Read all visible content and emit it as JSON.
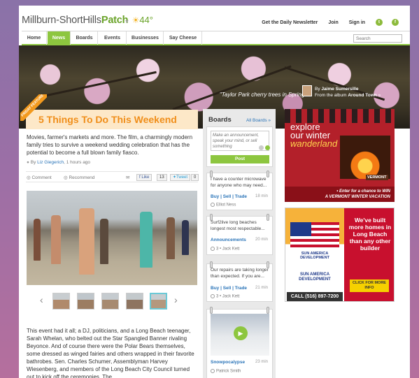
{
  "header": {
    "logo_main": "Millburn-ShortHills",
    "logo_brand": "Patch",
    "temperature": "44°",
    "weather_icon": "sun-icon",
    "links": [
      "Get the Daily Newsletter",
      "Join",
      "Sign in"
    ],
    "social": [
      "twitter-icon",
      "facebook-icon"
    ]
  },
  "nav": {
    "items": [
      "Home",
      "News",
      "Boards",
      "Events",
      "Businesses",
      "Say Cheese"
    ],
    "active": "News",
    "search_placeholder": "Search"
  },
  "hero": {
    "caption": "\"Taylor Park cherry trees in Spring\"",
    "by_prefix": "By",
    "author": "Jaime Sumersille",
    "album_prefix": "From the album",
    "album": "Around Town",
    "album_arrow": "»"
  },
  "article": {
    "ribbon": "FRIDAY FEATURE",
    "title": "5 Things To Do This Weekend",
    "summary": "Movies, farmer's markets and more. The film, a charmingly modern family tries to survive a weekend wedding celebration that has the potential to become a full blown family fiasco.",
    "byline_prefix": "By",
    "author": "Liz Giegerich",
    "time": ", 1 hours ago",
    "comment_label": "Comment",
    "recommend_label": "Recommend",
    "like_label": "Like",
    "like_count": "13",
    "tweet_label": "Tweet",
    "tweet_count": "0",
    "body": "This event had it all; a DJ, politicians, and a Long Beach teenager, Sarah Whelan, who belted out the Star Spangled Banner rivaling Beyonce. And of course there were the Polar Bears themselves, some dressed as winged fairies and others wrapped in their favorite bathrobes. Sen. Charles Schumer, Assemblyman Harvey Wiesenberg, and members of the Long Beach City Council turned out to kick off the ceremonies. The"
  },
  "boards": {
    "title": "Boards",
    "all_link": "All Boards »",
    "post_placeholder": "Make an announcement, speak your mind, or sell something",
    "post_button": "Post",
    "cards": [
      {
        "text": "I have a counter microwave for anyone who may need...",
        "category": "Buy | Sell | Trade",
        "time": "18 min",
        "user": "Elliot Ness"
      },
      {
        "text": "Surf2live long beaches longest most respectable...",
        "category": "Announcements",
        "time": "20 min",
        "user": "3 • Jack Kett"
      },
      {
        "text": "Our repairs are taking longer than expected. If you are...",
        "category": "Buy | Sell | Trade",
        "time": "21 min",
        "user": "3 • Jack Kett"
      },
      {
        "category": "Snowpocalypse",
        "time": "23 min",
        "user": "Patrick Smith"
      }
    ]
  },
  "ads": {
    "ad1": {
      "line1": "explore",
      "line2": "our winter",
      "line3": "wanderland",
      "badge": "VERMONT",
      "cta_line1": "• Enter for a chance to WIN",
      "cta_line2": "A VERMONT WINTER VACATION"
    },
    "ad2": {
      "company_top": "SUN AMERICA DEVELOPMENT",
      "company_line1": "SUN AMERICA",
      "company_line2": "DEVELOPMENT",
      "phone": "CALL (516) 897-7200",
      "headline": "We've built more homes in Long Beach than any other builder",
      "button": "CLICK FOR MORE INFO"
    }
  },
  "colors": {
    "brand_green": "#8dc63f",
    "title_orange": "#f08e1a",
    "link_blue": "#2a74b8",
    "background_purple": "#9c6fa6"
  }
}
